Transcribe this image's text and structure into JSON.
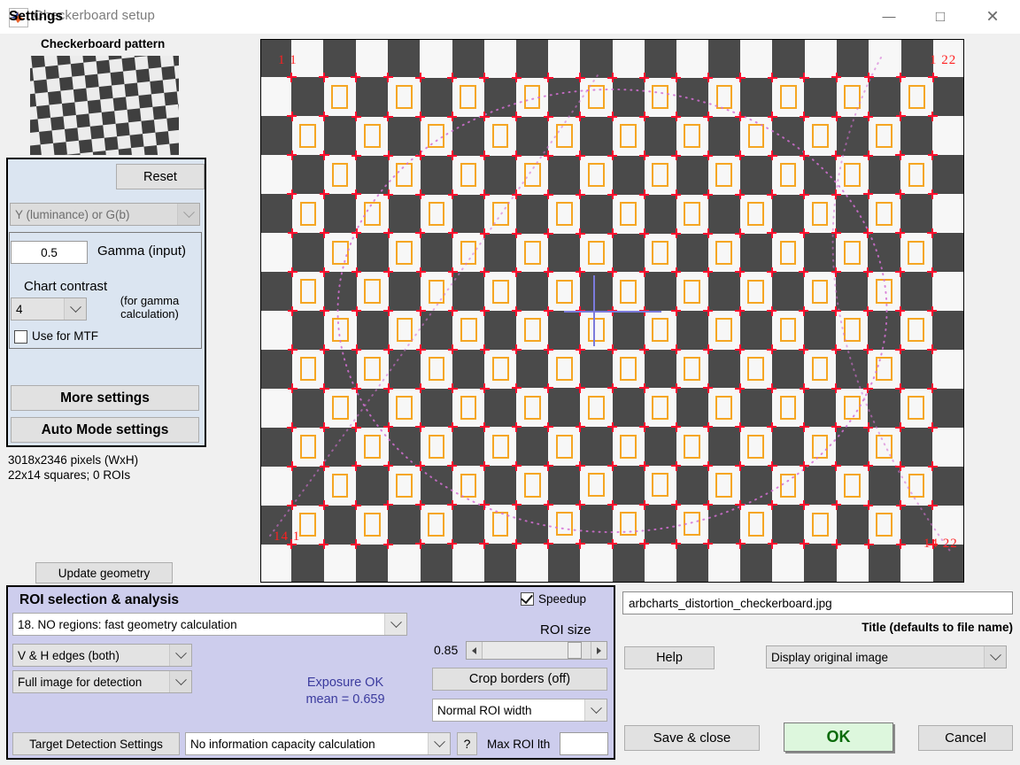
{
  "window": {
    "title": "Checkerboard setup",
    "icon": "matlab-app-icon",
    "controls": {
      "minimize": "—",
      "maximize": "□",
      "close": "✕"
    }
  },
  "left": {
    "pattern_label": "Checkerboard pattern",
    "settings": {
      "title": "Settings",
      "reset_label": "Reset",
      "channel_value": "Y (luminance) or G(b)",
      "gamma_value": "0.5",
      "gamma_label": "Gamma (input)",
      "contrast_label": "Chart contrast",
      "contrast_value": "4",
      "gamma_note_line1": "(for gamma",
      "gamma_note_line2": "calculation)",
      "use_for_mtf_label": "Use for MTF",
      "use_for_mtf_checked": false,
      "more_settings_label": "More settings",
      "auto_mode_label": "Auto Mode settings"
    },
    "info_line1": "3018x2346 pixels (WxH)",
    "info_line2": "22x14 squares; 0 ROIs",
    "update_geometry_label": "Update geometry"
  },
  "image": {
    "corner_top_left": "1 1",
    "corner_top_right": "1 22",
    "corner_bottom_left": "14 1",
    "corner_bottom_right": "14 22",
    "cols": 22,
    "rows": 14,
    "roi_color": "#f5a623",
    "corner_marker_color": "#ff0f2e",
    "crosshair_color": "#7b7bdc",
    "distortion_curve_color": "#d46fd4",
    "dark_square_color": "#4a4a4a",
    "light_square_color": "#f7f7f7"
  },
  "roi_panel": {
    "title": "ROI selection & analysis",
    "mode_value": "18. NO regions: fast geometry calculation",
    "edges_value": "V & H edges (both)",
    "detection_value": "Full image for detection",
    "target_detection_label": "Target Detection Settings",
    "infocap_value": "No information capacity calculation",
    "help_qmark_label": "?",
    "max_roi_label": "Max ROI lth",
    "max_roi_value": "",
    "speedup_label": "Speedup",
    "speedup_checked": true,
    "roi_size_label": "ROI size",
    "roi_size_value": "0.85",
    "crop_borders_label": "Crop borders  (off)",
    "roi_width_value": "Normal ROI width",
    "exposure_line1": "Exposure OK",
    "exposure_line2": "mean = 0.659",
    "exposure_color": "#3b3b9e"
  },
  "right": {
    "file_name": "arbcharts_distortion_checkerboard.jpg",
    "title_note": "Title (defaults to file name)",
    "help_label": "Help",
    "display_value": "Display original image",
    "save_close_label": "Save & close",
    "ok_label": "OK",
    "cancel_label": "Cancel",
    "ok_color": "#0a6b0a"
  }
}
